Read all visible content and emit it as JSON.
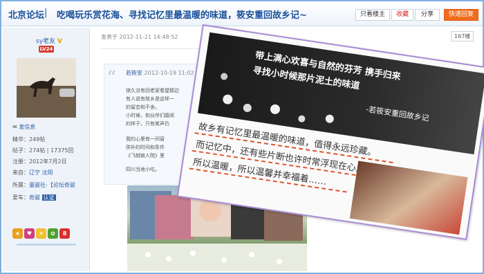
{
  "header": {
    "forum_name": "北京论坛",
    "separator": "|",
    "title": "吃喝玩乐赏花海、寻找记忆里最温暖的味道，筱安重回故乡记~",
    "buttons": {
      "only_op": "只看楼主",
      "favorite": "收藏",
      "share": "分享",
      "quick_reply": "快速回复"
    }
  },
  "user": {
    "name": "sy老友",
    "v_mark": "V",
    "level": "LV24",
    "send_message": "发信息",
    "essence": "精华：249帖",
    "posts": "帖子：274帖 | 17375回",
    "register": "注册：2012年7月2日",
    "from_label": "来自：",
    "from_value": "辽宁 沈阳",
    "belong_label": "所属：",
    "belong_value": "墨骏社-【论坛奇骏",
    "car_label": "爱车：",
    "car_value": "奇骏",
    "certified": "认证"
  },
  "post": {
    "meta": "发表于 2012-11-21 14:48:52",
    "floor": "167楼",
    "quote_author": "若筱安",
    "quote_date": "2012-10-19 11:02",
    "quote_lines": [
      "很久没有回老家看望那边",
      "有人说有故乡是这样一",
      "的留恋和不舍。",
      "小时候，和伙伴们嬉闹",
      "的样子，只有笑声仍",
      "我的心里有一间窗",
      "弥补的时间和条件",
      "《飞越疯人院》里",
      "四川当地小吃。"
    ]
  },
  "overlay": {
    "banner_line1": "带上满心欢喜与自然的芬芳  携手归来",
    "banner_line2": "寻找小时候那片泥土的味道",
    "banner_sign": "-若筱安重回故乡记",
    "text_line1": "故乡有记忆里最温暖的味道，值得永远珍藏。",
    "text_line2": "而记忆中，还有些片断也许时常浮现在心上。",
    "text_line3": "所以温暖，所以温馨并幸福着……"
  }
}
